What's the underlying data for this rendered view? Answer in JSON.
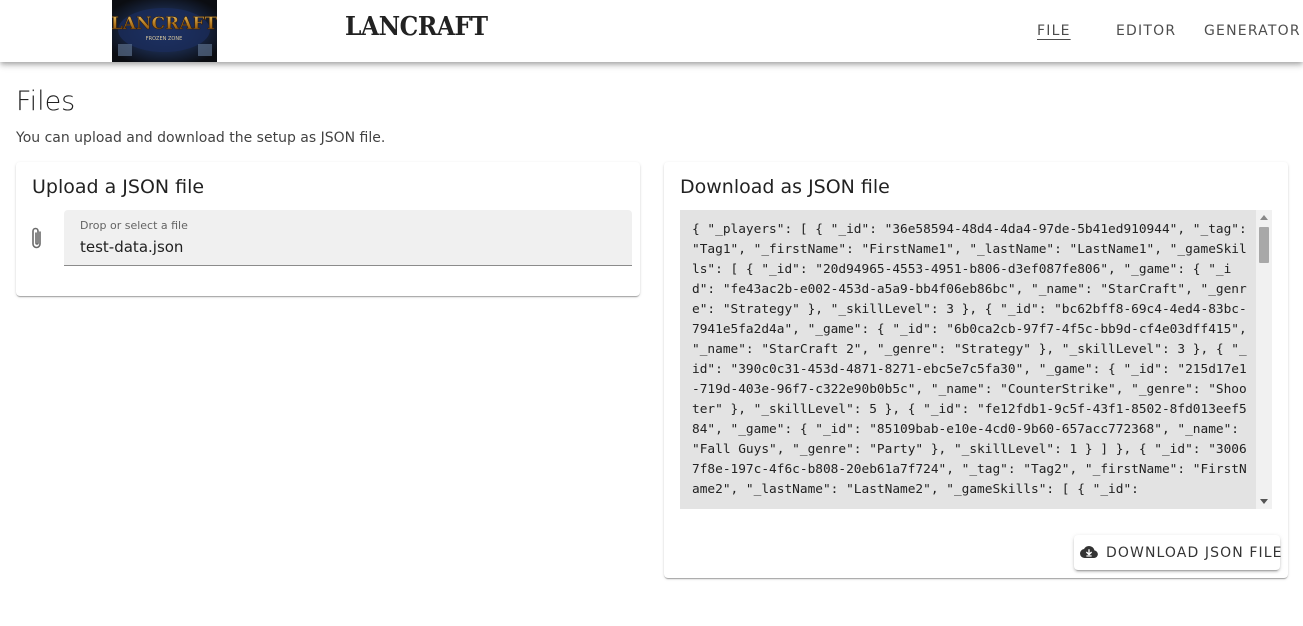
{
  "header": {
    "logo_text": "LANCRAFT",
    "logo_subtitle": "FROZEN ZONE",
    "brand": "LANCRAFT",
    "nav": [
      {
        "label": "FILE",
        "active": true
      },
      {
        "label": "EDITOR",
        "active": false
      },
      {
        "label": "GENERATOR",
        "active": false
      }
    ]
  },
  "page": {
    "title": "Files",
    "subtitle": "You can upload and download the setup as JSON file."
  },
  "upload": {
    "title": "Upload a JSON file",
    "field_label": "Drop or select a file",
    "file_name": "test-data.json",
    "icon": "paperclip-icon"
  },
  "download": {
    "title": "Download as JSON file",
    "json_text": "{ \"_players\": [ { \"_id\": \"36e58594-48d4-4da4-97de-5b41ed910944\", \"_tag\": \"Tag1\", \"_firstName\": \"FirstName1\", \"_lastName\": \"LastName1\", \"_gameSkills\": [ { \"_id\": \"20d94965-4553-4951-b806-d3ef087fe806\", \"_game\": { \"_id\": \"fe43ac2b-e002-453d-a5a9-bb4f06eb86bc\", \"_name\": \"StarCraft\", \"_genre\": \"Strategy\" }, \"_skillLevel\": 3 }, { \"_id\": \"bc62bff8-69c4-4ed4-83bc-7941e5fa2d4a\", \"_game\": { \"_id\": \"6b0ca2cb-97f7-4f5c-bb9d-cf4e03dff415\", \"_name\": \"StarCraft 2\", \"_genre\": \"Strategy\" }, \"_skillLevel\": 3 }, { \"_id\": \"390c0c31-453d-4871-8271-ebc5e7c5fa30\", \"_game\": { \"_id\": \"215d17e1-719d-403e-96f7-c322e90b0b5c\", \"_name\": \"CounterStrike\", \"_genre\": \"Shooter\" }, \"_skillLevel\": 5 }, { \"_id\": \"fe12fdb1-9c5f-43f1-8502-8fd013eef584\", \"_game\": { \"_id\": \"85109bab-e10e-4cd0-9b60-657acc772368\", \"_name\": \"Fall Guys\", \"_genre\": \"Party\" }, \"_skillLevel\": 1 } ] }, { \"_id\": \"30067f8e-197c-4f6c-b808-20eb61a7f724\", \"_tag\": \"Tag2\", \"_firstName\": \"FirstName2\", \"_lastName\": \"LastName2\", \"_gameSkills\": [ { \"_id\":",
    "button_label": "DOWNLOAD JSON FILE",
    "button_icon": "cloud-download-icon"
  },
  "colors": {
    "field_bg": "#f0f0f0",
    "json_bg": "#e3e3e3"
  }
}
